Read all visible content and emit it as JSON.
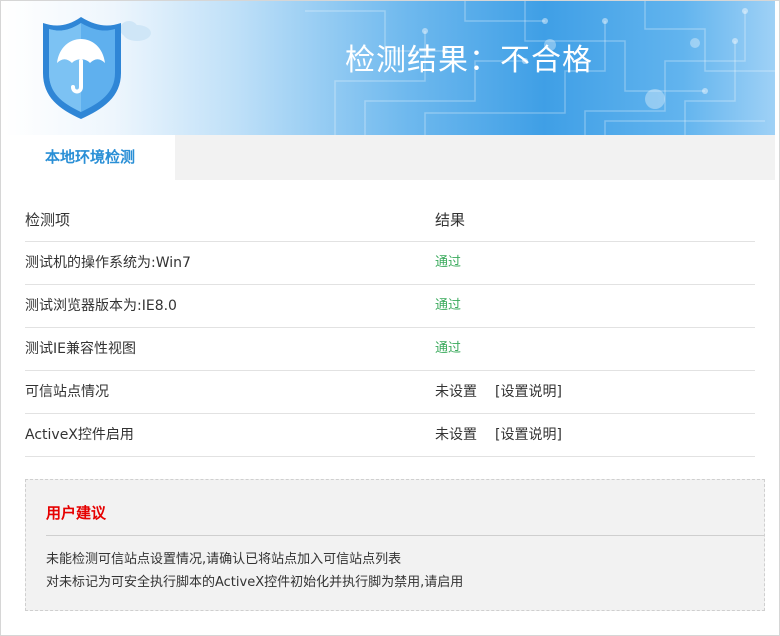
{
  "banner": {
    "title": "检测结果：不合格"
  },
  "tabs": [
    {
      "label": "本地环境检测",
      "active": true
    }
  ],
  "table": {
    "headers": {
      "item": "检测项",
      "result": "结果"
    },
    "rows": [
      {
        "item": "测试机的操作系统为:Win7",
        "result": "通过",
        "status": "pass",
        "link": ""
      },
      {
        "item": "测试浏览器版本为:IE8.0",
        "result": "通过",
        "status": "pass",
        "link": ""
      },
      {
        "item": "测试IE兼容性视图",
        "result": "通过",
        "status": "pass",
        "link": ""
      },
      {
        "item": "可信站点情况",
        "result": "未设置",
        "status": "fail",
        "link": "[设置说明]"
      },
      {
        "item": "ActiveX控件启用",
        "result": "未设置",
        "status": "fail",
        "link": "[设置说明]"
      }
    ]
  },
  "advice": {
    "title": "用户建议",
    "lines": [
      "未能检测可信站点设置情况,请确认已将站点加入可信站点列表",
      "对未标记为可安全执行脚本的ActiveX控件初始化并执行脚为禁用,请启用"
    ]
  },
  "colors": {
    "pass": "#3aaa5c",
    "advice_title": "#e60000",
    "tab_active": "#2a8fd6"
  },
  "icons": {
    "logo": "shield-umbrella-icon"
  }
}
